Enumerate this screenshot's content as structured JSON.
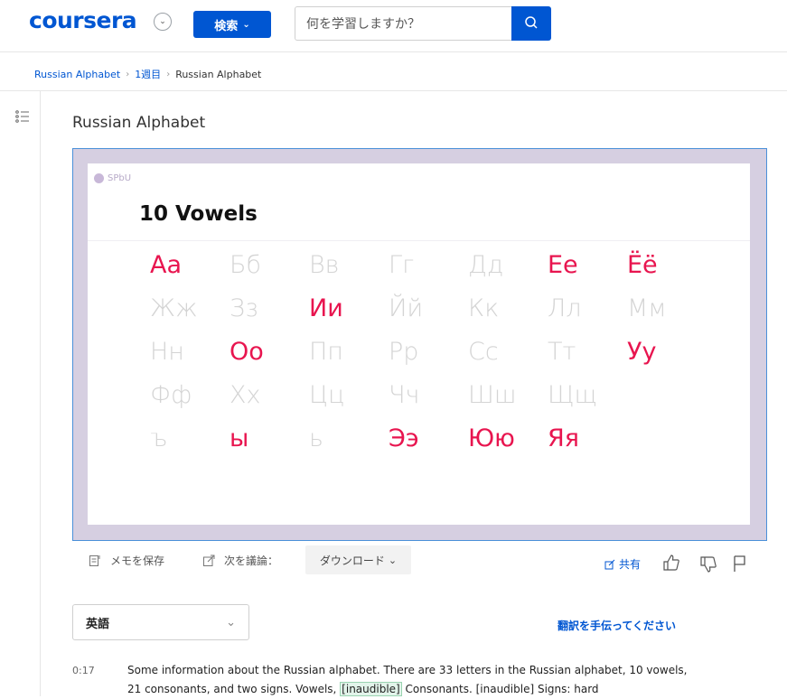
{
  "header": {
    "logo": "coursera",
    "explore_label": "検索",
    "search_placeholder": "何を学習しますか？"
  },
  "breadcrumb": {
    "course": "Russian Alphabet",
    "week": "1週目",
    "current": "Russian Alphabet"
  },
  "lesson": {
    "title": "Russian Alphabet"
  },
  "slide": {
    "brand": "SPbU",
    "title": "10 Vowels",
    "rows": [
      [
        {
          "t": "Аа",
          "v": true
        },
        {
          "t": "Бб",
          "v": false
        },
        {
          "t": "Вв",
          "v": false
        },
        {
          "t": "Гг",
          "v": false
        },
        {
          "t": "Дд",
          "v": false
        },
        {
          "t": "Ее",
          "v": true
        },
        {
          "t": "Ёё",
          "v": true
        }
      ],
      [
        {
          "t": "Жж",
          "v": false
        },
        {
          "t": "Зз",
          "v": false
        },
        {
          "t": "Ии",
          "v": true
        },
        {
          "t": "Йй",
          "v": false
        },
        {
          "t": "Кк",
          "v": false
        },
        {
          "t": "Лл",
          "v": false
        },
        {
          "t": "Мм",
          "v": false
        }
      ],
      [
        {
          "t": "Нн",
          "v": false
        },
        {
          "t": "Оо",
          "v": true
        },
        {
          "t": "Пп",
          "v": false
        },
        {
          "t": "Рр",
          "v": false
        },
        {
          "t": "Сс",
          "v": false
        },
        {
          "t": "Тт",
          "v": false
        },
        {
          "t": "Уу",
          "v": true
        }
      ],
      [
        {
          "t": "Фф",
          "v": false
        },
        {
          "t": "Хх",
          "v": false
        },
        {
          "t": "Цц",
          "v": false
        },
        {
          "t": "Чч",
          "v": false
        },
        {
          "t": "Шш",
          "v": false
        },
        {
          "t": "Щщ",
          "v": false
        },
        {
          "t": "",
          "v": false
        }
      ],
      [
        {
          "t": "ъ",
          "v": false
        },
        {
          "t": "ы",
          "v": true
        },
        {
          "t": "ь",
          "v": false
        },
        {
          "t": "Ээ",
          "v": true
        },
        {
          "t": "Юю",
          "v": true
        },
        {
          "t": "Яя",
          "v": true
        },
        {
          "t": "",
          "v": false
        }
      ]
    ]
  },
  "toolbar": {
    "save_note": "メモを保存",
    "discuss": "次を議論：",
    "download": "ダウンロード",
    "share": "共有"
  },
  "transcript": {
    "language": "英語",
    "help_translate": "翻訳を手伝ってください",
    "timestamp": "0:17",
    "text_a": "Some information about the Russian alphabet. There are 33 letters in the Russian alphabet, 10 vowels, 21 consonants, and two signs. Vowels, ",
    "inaudible": "[inaudible]",
    "text_b": " Consonants. [inaudible] Signs: hard"
  },
  "colors": {
    "brand": "#0056d2",
    "vowel": "#e8154f",
    "consonant": "#d4d4d4"
  }
}
